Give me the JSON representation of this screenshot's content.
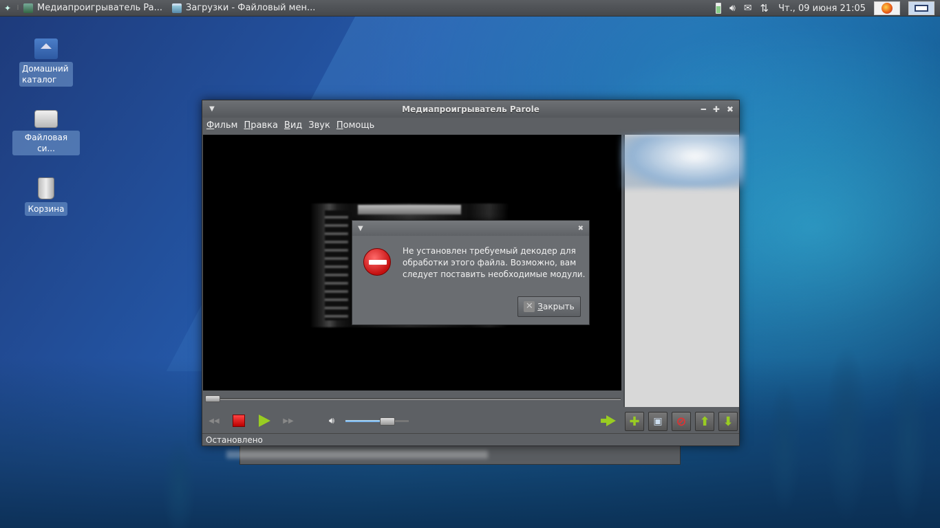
{
  "panel": {
    "tasks": [
      {
        "label": "Медиапроигрыватель Pa..."
      },
      {
        "label": "Загрузки - Файловый мен..."
      }
    ],
    "clock": "Чт., 09 июня  21:05"
  },
  "desktop": {
    "icons": [
      {
        "label": "Домашний\nкаталог"
      },
      {
        "label": "Файловая си..."
      },
      {
        "label": "Корзина"
      }
    ]
  },
  "player": {
    "title": "Медиапроигрыватель Parole",
    "menu": [
      {
        "label": "Фильм",
        "mnemonic": "Ф",
        "rest": "ильм"
      },
      {
        "label": "Правка",
        "mnemonic": "П",
        "rest": "равка"
      },
      {
        "label": "Вид",
        "mnemonic": "В",
        "rest": "ид"
      },
      {
        "label": "Звук",
        "mnemonic": "З",
        "rest": "вук"
      },
      {
        "label": "Помощь",
        "mnemonic": "П",
        "rest": "омощь"
      }
    ],
    "status": "Остановлено",
    "seek_fraction": 0.0,
    "volume_fraction": 0.72
  },
  "dialog": {
    "message": "Не установлен требуемый декодер для обработки этого файла. Возможно, вам следует поставить необходимые модули.",
    "close_label": "Закрыть",
    "close_mnemonic": "З",
    "close_rest": "акрыть"
  },
  "colors": {
    "accent_green": "#99cc22",
    "stop_red": "#dd2222"
  }
}
